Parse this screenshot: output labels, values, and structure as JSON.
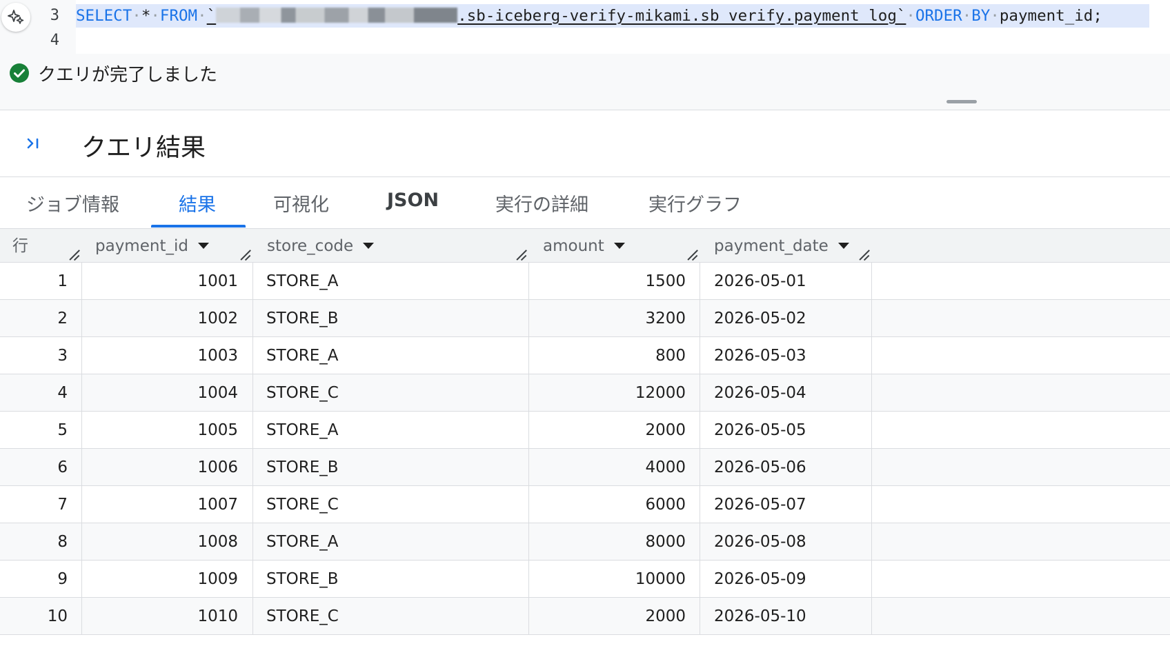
{
  "editor": {
    "line_numbers": [
      "3",
      "4"
    ],
    "code": {
      "kw_select": "SELECT",
      "star": "*",
      "kw_from": "FROM",
      "table_ref": ".sb-iceberg-verify-mikami.sb_verify.payment_log`",
      "kw_order": "ORDER",
      "kw_by": "BY",
      "order_col": "payment_id;"
    }
  },
  "status": {
    "text": "クエリが完了しました",
    "color": "#188038"
  },
  "results": {
    "title": "クエリ結果",
    "tabs": [
      "ジョブ情報",
      "結果",
      "可視化",
      "JSON",
      "実行の詳細",
      "実行グラフ"
    ],
    "active_tab": "結果"
  },
  "table": {
    "columns": [
      "行",
      "payment_id",
      "store_code",
      "amount",
      "payment_date"
    ],
    "rows": [
      [
        "1",
        "1001",
        "STORE_A",
        "1500",
        "2026-05-01"
      ],
      [
        "2",
        "1002",
        "STORE_B",
        "3200",
        "2026-05-02"
      ],
      [
        "3",
        "1003",
        "STORE_A",
        "800",
        "2026-05-03"
      ],
      [
        "4",
        "1004",
        "STORE_C",
        "12000",
        "2026-05-04"
      ],
      [
        "5",
        "1005",
        "STORE_A",
        "2000",
        "2026-05-05"
      ],
      [
        "6",
        "1006",
        "STORE_B",
        "4000",
        "2026-05-06"
      ],
      [
        "7",
        "1007",
        "STORE_C",
        "6000",
        "2026-05-07"
      ],
      [
        "8",
        "1008",
        "STORE_A",
        "8000",
        "2026-05-08"
      ],
      [
        "9",
        "1009",
        "STORE_B",
        "10000",
        "2026-05-09"
      ],
      [
        "10",
        "1010",
        "STORE_C",
        "2000",
        "2026-05-10"
      ]
    ]
  },
  "colors": {
    "accent": "#1a73e8",
    "success": "#188038",
    "selection": "#dfe8fb"
  }
}
